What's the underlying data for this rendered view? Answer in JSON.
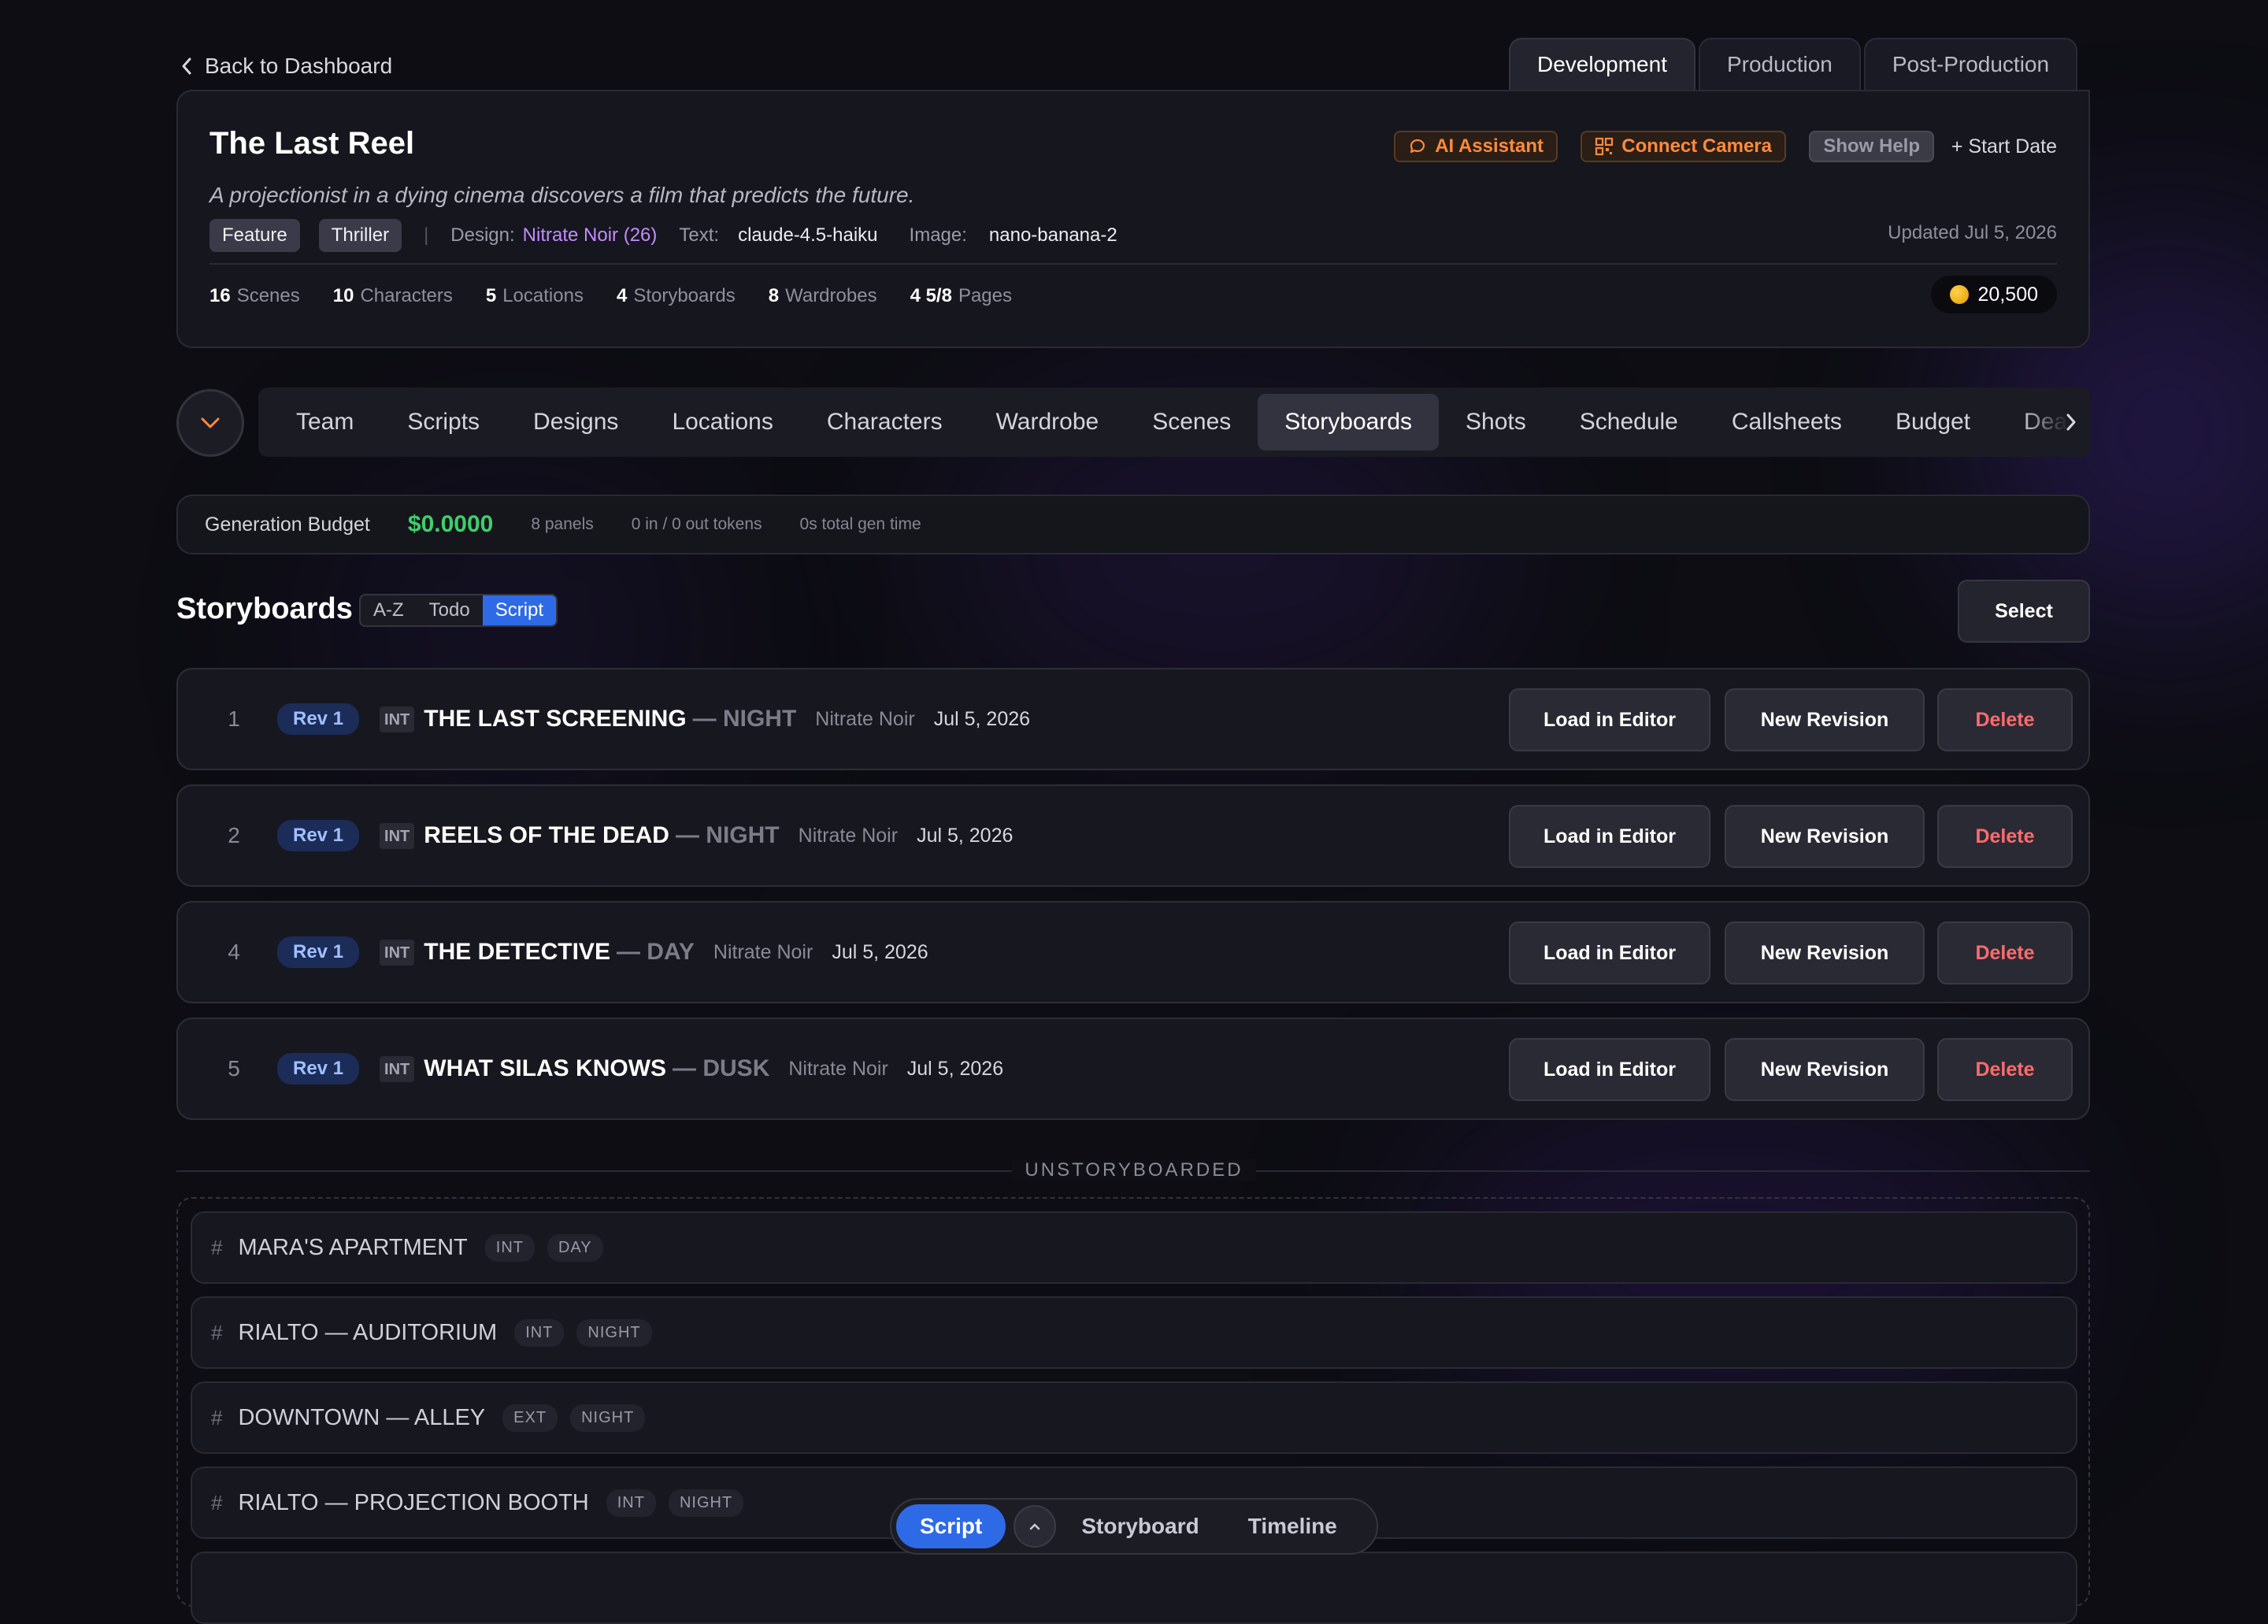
{
  "back": {
    "label": "Back to Dashboard"
  },
  "phase_tabs": [
    "Development",
    "Production",
    "Post-Production"
  ],
  "project": {
    "title": "The Last Reel",
    "logline": "A projectionist in a dying cinema discovers a film that predicts the future.",
    "tags": [
      "Feature",
      "Thriller"
    ],
    "separator": "|",
    "design_label": "Design:",
    "design_value": "Nitrate Noir (26)",
    "text_label": "Text:",
    "text_value": "claude-4.5-haiku",
    "image_label": "Image:",
    "image_value": "nano-banana-2",
    "updated": "Updated Jul 5, 2026",
    "stats": [
      {
        "value": "16",
        "label": "Scenes"
      },
      {
        "value": "10",
        "label": "Characters"
      },
      {
        "value": "5",
        "label": "Locations"
      },
      {
        "value": "4",
        "label": "Storyboards"
      },
      {
        "value": "8",
        "label": "Wardrobes"
      },
      {
        "value": "4 5/8",
        "label": "Pages"
      }
    ],
    "credits": "20,500"
  },
  "toolbar": {
    "ai_assistant": "AI Assistant",
    "connect_camera": "Connect Camera",
    "show_help": "Show Help",
    "start_date": "+ Start Date"
  },
  "nav": {
    "items": [
      "Team",
      "Scripts",
      "Designs",
      "Locations",
      "Characters",
      "Wardrobe",
      "Scenes",
      "Storyboards",
      "Shots",
      "Schedule",
      "Callsheets",
      "Budget",
      "Deal"
    ],
    "active": "Storyboards"
  },
  "budget": {
    "label": "Generation Budget",
    "amount": "$0.0000",
    "panels": "8 panels",
    "tokens": "0 in / 0 out tokens",
    "gen_time": "0s total gen time"
  },
  "storyboards": {
    "title": "Storyboards",
    "sort_options": [
      "A-Z",
      "Todo",
      "Script"
    ],
    "sort_active": "Script",
    "select_label": "Select",
    "actions": {
      "load": "Load in Editor",
      "revision": "New Revision",
      "delete": "Delete"
    },
    "rows": [
      {
        "num": "1",
        "rev": "Rev 1",
        "int": "INT",
        "name": "THE LAST SCREENING",
        "tod": "— NIGHT",
        "style": "Nitrate Noir",
        "date": "Jul 5, 2026"
      },
      {
        "num": "2",
        "rev": "Rev 1",
        "int": "INT",
        "name": "REELS OF THE DEAD",
        "tod": "— NIGHT",
        "style": "Nitrate Noir",
        "date": "Jul 5, 2026"
      },
      {
        "num": "4",
        "rev": "Rev 1",
        "int": "INT",
        "name": "THE DETECTIVE",
        "tod": "— DAY",
        "style": "Nitrate Noir",
        "date": "Jul 5, 2026"
      },
      {
        "num": "5",
        "rev": "Rev 1",
        "int": "INT",
        "name": "WHAT SILAS KNOWS",
        "tod": "— DUSK",
        "style": "Nitrate Noir",
        "date": "Jul 5, 2026"
      }
    ]
  },
  "unstoryboarded": {
    "label": "UNSTORYBOARDED",
    "rows": [
      {
        "hash": "#",
        "name": "MARA'S APARTMENT",
        "badges": [
          "INT",
          "DAY"
        ]
      },
      {
        "hash": "#",
        "name": "RIALTO — AUDITORIUM",
        "badges": [
          "INT",
          "NIGHT"
        ]
      },
      {
        "hash": "#",
        "name": "DOWNTOWN — ALLEY",
        "badges": [
          "EXT",
          "NIGHT"
        ]
      },
      {
        "hash": "#",
        "name": "RIALTO — PROJECTION BOOTH",
        "badges": [
          "INT",
          "NIGHT"
        ]
      }
    ]
  },
  "bottom_bar": {
    "script": "Script",
    "storyboard": "Storyboard",
    "timeline": "Timeline"
  },
  "colors": {
    "accent_blue": "#2f6ae6",
    "orange": "#ff8a3d",
    "green": "#3ecf6b",
    "red": "#ff6b6b",
    "purple": "#c18cff"
  }
}
